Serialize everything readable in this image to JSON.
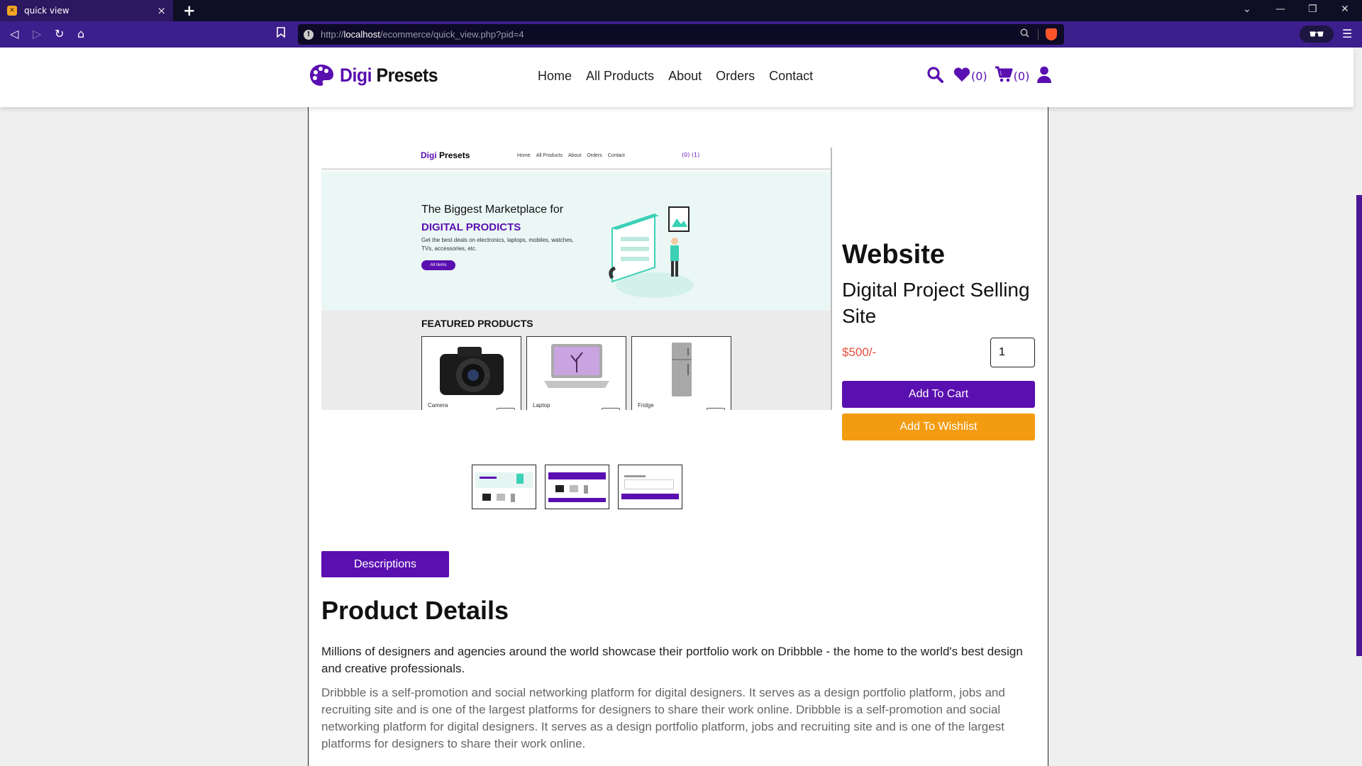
{
  "browser": {
    "tab_title": "quick view",
    "tab_close": "×",
    "new_tab": "+",
    "url_scheme": "http://",
    "url_host": "localhost",
    "url_path": "/ecommerce/quick_view.php?pid=4"
  },
  "header": {
    "logo_part1": "Digi",
    "logo_part2": "Presets",
    "nav": [
      "Home",
      "All Products",
      "About",
      "Orders",
      "Contact"
    ],
    "wishlist_count": "(0)",
    "cart_count": "(0)"
  },
  "preview": {
    "logo_part1": "Digi",
    "logo_part2": "Presets",
    "nav": [
      "Home",
      "All Products",
      "About",
      "Orders",
      "Contact"
    ],
    "icons_text": "(0)  (1)",
    "hero_title": "The Biggest Marketplace for",
    "hero_highlight": "DIGITAL PRODICTS",
    "hero_text": "Get the best deals on electronics, laptops, mobiles, watches, TVs, accessories, etc.",
    "hero_button": "All Items",
    "featured_title": "FEATURED PRODUCTS",
    "cards": [
      "Camera",
      "Laptop",
      "Fridge"
    ]
  },
  "product": {
    "category": "Website",
    "name": "Digital Project Selling Site",
    "price": "$500/-",
    "quantity": "1",
    "add_to_cart": "Add To Cart",
    "add_to_wishlist": "Add To Wishlist"
  },
  "details": {
    "tab_label": "Descriptions",
    "title": "Product Details",
    "paragraph1": "Millions of designers and agencies around the world showcase their portfolio work on Dribbble - the home to the world's best design and creative professionals.",
    "paragraph2": "Dribbble is a self-promotion and social networking platform for digital designers. It serves as a design portfolio platform, jobs and recruiting site and is one of the largest platforms for designers to share their work online. Dribbble is a self-promotion and social networking platform for digital designers. It serves as a design portfolio platform, jobs and recruiting site and is one of the largest platforms for designers to share their work online."
  },
  "colors": {
    "brand": "#5a0fb0",
    "price": "#e74c3c",
    "wishlist_button": "#f39c12",
    "browser_toolbar": "#3c1f8c"
  }
}
